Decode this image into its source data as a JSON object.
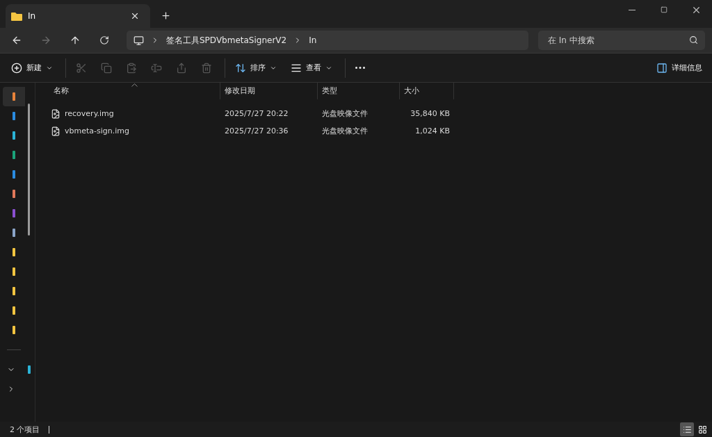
{
  "tab": {
    "title": "In"
  },
  "address": {
    "crumbs": [
      "签名工具SPDVbmetaSignerV2",
      "In"
    ]
  },
  "search": {
    "placeholder": "在 In 中搜索"
  },
  "toolbar": {
    "items": [
      {
        "kind": "new",
        "label": "新建",
        "disabled": false
      },
      {
        "kind": "cut",
        "disabled": true
      },
      {
        "kind": "copy",
        "disabled": true
      },
      {
        "kind": "paste",
        "disabled": true
      },
      {
        "kind": "rename",
        "disabled": true
      },
      {
        "kind": "share",
        "disabled": true
      },
      {
        "kind": "delete",
        "disabled": true
      },
      {
        "kind": "sort",
        "label": "排序",
        "disabled": false
      },
      {
        "kind": "view",
        "label": "查看",
        "disabled": false
      },
      {
        "kind": "more",
        "disabled": false
      }
    ],
    "details": "详细信息"
  },
  "sidebar": {
    "items": [
      {
        "color": "#e8833a",
        "selected": true
      },
      {
        "color": "#2a8be0",
        "selected": false
      },
      {
        "color": "#2bb3d6",
        "selected": false
      },
      {
        "color": "#1ba37a",
        "selected": false
      },
      {
        "color": "#2a8be0",
        "selected": false
      },
      {
        "color": "#e0785a",
        "selected": false
      },
      {
        "color": "#8a4fd0",
        "selected": false
      },
      {
        "color": "#8aa4c8",
        "selected": false
      },
      {
        "color": "#f2c440",
        "selected": false
      },
      {
        "color": "#f2c440",
        "selected": false
      },
      {
        "color": "#f2c440",
        "selected": false
      },
      {
        "color": "#f2c440",
        "selected": false
      },
      {
        "color": "#f2c440",
        "selected": false
      }
    ],
    "bottom": [
      {
        "expanded": true,
        "color": "#2bb3d6"
      },
      {
        "expanded": false
      }
    ]
  },
  "table": {
    "columns": [
      "名称",
      "修改日期",
      "类型",
      "大小"
    ],
    "rows": [
      {
        "name": "recovery.img",
        "date": "2025/7/27 20:22",
        "type": "光盘映像文件",
        "size": "35,840 KB"
      },
      {
        "name": "vbmeta-sign.img",
        "date": "2025/7/27 20:36",
        "type": "光盘映像文件",
        "size": "1,024 KB"
      }
    ]
  },
  "status_bar": {
    "count": "2 个项目",
    "views": [
      {
        "kind": "details",
        "selected": true
      },
      {
        "kind": "tiles",
        "selected": false
      }
    ]
  }
}
